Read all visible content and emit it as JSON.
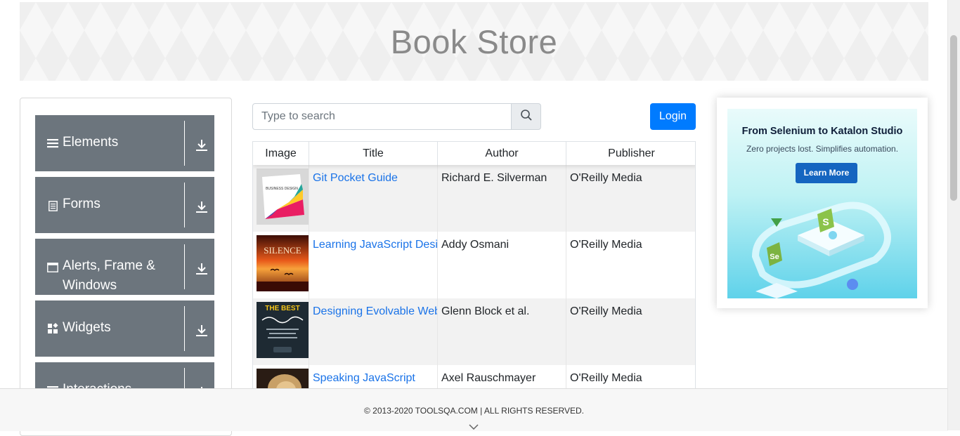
{
  "header": {
    "title": "Book Store"
  },
  "sidebar": {
    "groups": [
      {
        "label": "Elements",
        "icon": "bars-icon"
      },
      {
        "label": "Forms",
        "icon": "document-icon"
      },
      {
        "label": "Alerts, Frame & Windows",
        "icon": "window-icon"
      },
      {
        "label": "Widgets",
        "icon": "widgets-icon"
      },
      {
        "label": "Interactions",
        "icon": "bars-icon"
      }
    ]
  },
  "search": {
    "placeholder": "Type to search",
    "value": ""
  },
  "login_label": "Login",
  "table": {
    "columns": [
      "Image",
      "Title",
      "Author",
      "Publisher"
    ],
    "rows": [
      {
        "title": "Git Pocket Guide",
        "author": "Richard E. Silverman",
        "publisher": "O'Reilly Media",
        "cover_text": "BUSINESS DESIGN"
      },
      {
        "title": "Learning JavaScript Design Patterns",
        "author": "Addy Osmani",
        "publisher": "O'Reilly Media",
        "cover_text": "SILENCE"
      },
      {
        "title": "Designing Evolvable Web APIs with ASP.NET",
        "author": "Glenn Block et al.",
        "publisher": "O'Reilly Media",
        "cover_text": "THE BEST"
      },
      {
        "title": "Speaking JavaScript",
        "author": "Axel Rauschmayer",
        "publisher": "O'Reilly Media",
        "cover_text": ""
      }
    ]
  },
  "ad": {
    "title": "From Selenium to Katalon Studio",
    "subtitle": "Zero projects lost. Simplifies automation.",
    "button": "Learn More"
  },
  "footer": {
    "copyright": "© 2013-2020 TOOLSQA.COM | ALL RIGHTS RESERVED."
  },
  "colors": {
    "sidebar_group": "#6c757d",
    "primary": "#007bff",
    "link": "#1a73e8",
    "stripe": "#f2f2f2"
  }
}
